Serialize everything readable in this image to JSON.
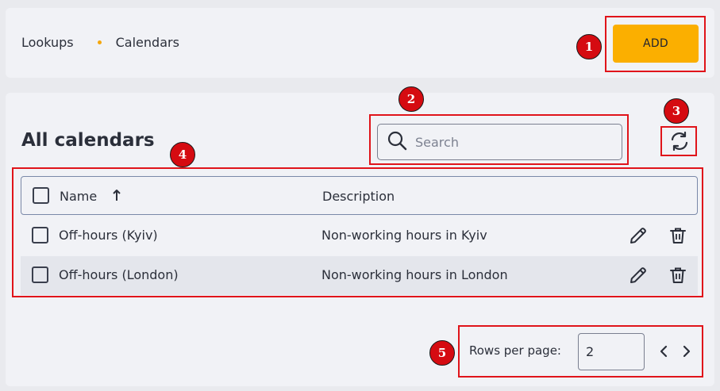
{
  "breadcrumb": {
    "items": [
      "Lookups",
      "Calendars"
    ]
  },
  "toolbar": {
    "add_label": "ADD"
  },
  "page": {
    "title": "All calendars"
  },
  "search": {
    "placeholder": "Search",
    "value": ""
  },
  "table": {
    "columns": {
      "name": "Name",
      "description": "Description"
    },
    "sort": {
      "column": "name",
      "direction": "ascending"
    },
    "rows": [
      {
        "name": "Off-hours (Kyiv)",
        "description": "Non-working hours in Kyiv"
      },
      {
        "name": "Off-hours (London)",
        "description": "Non-working hours in London"
      }
    ]
  },
  "pagination": {
    "rows_per_page_label": "Rows per page:",
    "rows_per_page_value": "2"
  },
  "annotations": [
    "1",
    "2",
    "3",
    "4",
    "5"
  ],
  "colors": {
    "accent": "#fbaf00",
    "highlight": "#e0141a",
    "badge": "#d50b11",
    "bullet": "#f5a70c"
  },
  "icons": [
    "search-icon",
    "refresh-icon",
    "sort-ascending-icon",
    "edit-pencil-icon",
    "trash-icon",
    "chevron-left-icon",
    "chevron-right-icon"
  ]
}
